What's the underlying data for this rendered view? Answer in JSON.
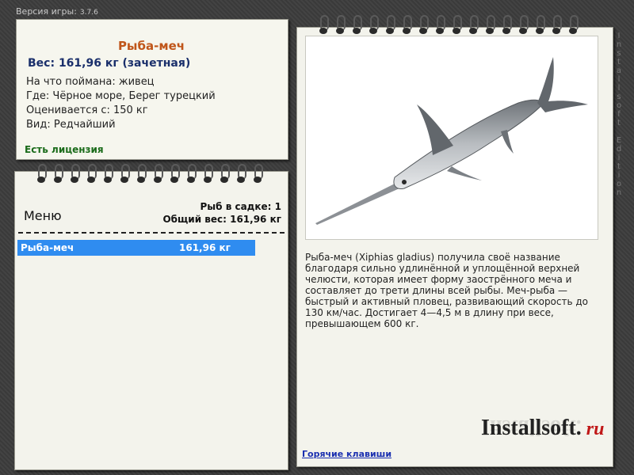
{
  "header": {
    "version_label": "Версия игры:",
    "version_number": "3.7.6"
  },
  "fish_card": {
    "title": "Рыба-меч",
    "weight_line": "Вес: 161,96 кг (зачетная)",
    "caught_on": "На что поймана: живец",
    "where": "Где: Чёрное море, Берег турецкий",
    "valued_from": "Оценивается с: 150 кг",
    "kind": "Вид: Редчайший",
    "license": "Есть лицензия"
  },
  "keepnet": {
    "menu_label": "Меню",
    "fish_count": "Рыб в садке: 1",
    "total_weight": "Общий вес: 161,96 кг",
    "rows": [
      {
        "name": "Рыба-меч",
        "weight": "161,96 кг"
      }
    ]
  },
  "details": {
    "description": "Рыба-меч (Xiphias gladius) получила своё название благодаря сильно удлинённой и уплощённой верхней челюсти, которая имеет форму заострённого меча и составляет до трети длины всей рыбы. Меч-рыба — быстрый и активный пловец, развивающий скорость до 130 км/час. Достигает 4—4,5 м в длину при весе, превышающем 600 кг.",
    "hotkeys_link": "Горячие клавиши"
  },
  "branding": {
    "logo_main": "Installsoft.",
    "logo_ru": "ru",
    "watermark": "Installsoft Edition"
  },
  "colors": {
    "title_orange": "#c0561a",
    "weight_blue": "#1a2f6b",
    "license_green": "#1a6b1a",
    "selection_blue": "#2f8cf0"
  }
}
